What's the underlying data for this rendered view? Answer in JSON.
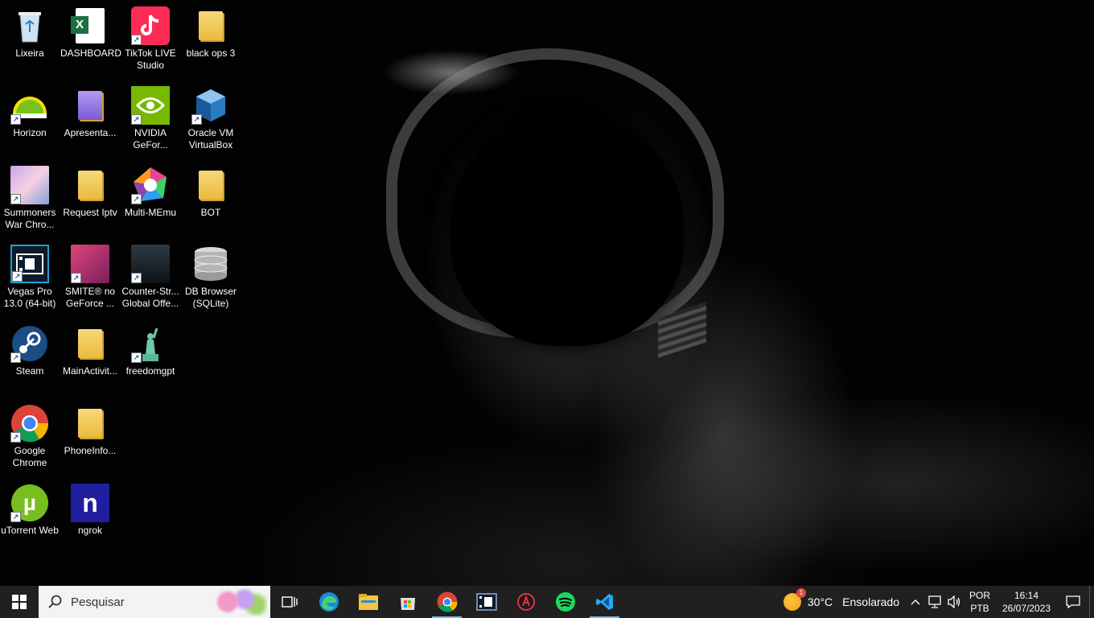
{
  "desktop": {
    "icons": [
      {
        "label": "Lixeira"
      },
      {
        "label": "DASHBOARD"
      },
      {
        "label": "TikTok LIVE\nStudio"
      },
      {
        "label": "black ops 3"
      },
      {
        "label": "Horizon"
      },
      {
        "label": "Apresenta..."
      },
      {
        "label": "NVIDIA\nGeFor..."
      },
      {
        "label": "Oracle VM\nVirtualBox"
      },
      {
        "label": "Summoners\nWar Chro..."
      },
      {
        "label": "Request Iptv"
      },
      {
        "label": "Multi-MEmu"
      },
      {
        "label": "BOT"
      },
      {
        "label": "Vegas Pro\n13.0 (64-bit)"
      },
      {
        "label": "SMITE® no\nGeForce ..."
      },
      {
        "label": "Counter-Str...\nGlobal Offe..."
      },
      {
        "label": "DB Browser\n(SQLite)"
      },
      {
        "label": "Steam"
      },
      {
        "label": "MainActivit..."
      },
      {
        "label": "freedomgpt"
      },
      {
        "label": "Google\nChrome"
      },
      {
        "label": "PhoneInfo..."
      },
      {
        "label": "uTorrent Web"
      },
      {
        "label": "ngrok"
      }
    ],
    "icon_glyphs": {
      "excel": "X",
      "ngrok": "n",
      "utorrent": "µ"
    }
  },
  "taskbar": {
    "search_placeholder": "Pesquisar",
    "weather_temp": "30°C",
    "weather_desc": "Ensolarado",
    "weather_badge": "1",
    "lang_top": "POR",
    "lang_bottom": "PTB",
    "time": "16:14",
    "date": "26/07/2023"
  },
  "colors": {
    "taskbar_bg": "#202020",
    "active_indicator": "#76b9ed"
  }
}
